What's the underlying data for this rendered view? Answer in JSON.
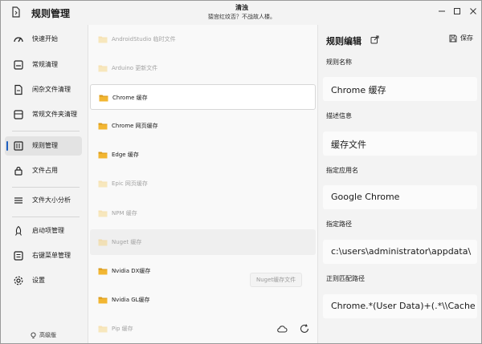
{
  "app": {
    "title": "规则管理",
    "header_title": "清浊",
    "header_subtitle": "猿宫红纹否？不战故人楼。"
  },
  "sidebar": {
    "items": [
      {
        "label": "快速开始",
        "icon": "gauge-icon"
      },
      {
        "label": "常规清理",
        "icon": "broom-icon"
      },
      {
        "label": "闲杂文件清理",
        "icon": "file-icon"
      },
      {
        "label": "常规文件夹清理",
        "icon": "folder-clean-icon"
      },
      {
        "label": "规则管理",
        "icon": "rules-icon",
        "active": true
      },
      {
        "label": "文件占用",
        "icon": "lock-icon"
      },
      {
        "label": "文件大小分析",
        "icon": "list-icon"
      },
      {
        "label": "启动项管理",
        "icon": "rocket-icon"
      },
      {
        "label": "右键菜单管理",
        "icon": "menu-icon"
      },
      {
        "label": "设置",
        "icon": "gear-icon"
      }
    ],
    "version": "高级版"
  },
  "rules": {
    "items": [
      {
        "name": "AndroidStudio 临时文件",
        "enabled": false
      },
      {
        "name": "Arduino 更新文件",
        "enabled": false
      },
      {
        "name": "Chrome 缓存",
        "enabled": true,
        "selected": true
      },
      {
        "name": "Chrome 网页缓存",
        "enabled": true
      },
      {
        "name": "Edge 缓存",
        "enabled": true
      },
      {
        "name": "Epic 网页缓存",
        "enabled": false
      },
      {
        "name": "NPM 缓存",
        "enabled": false
      },
      {
        "name": "Nuget 缓存",
        "enabled": false,
        "hover": true
      },
      {
        "name": "Nvidia DX缓存",
        "enabled": true
      },
      {
        "name": "Nvidia GL缓存",
        "enabled": true
      },
      {
        "name": "Pip 缓存",
        "enabled": false
      }
    ],
    "tooltip": "Nuget缓存文件"
  },
  "editor": {
    "title": "规则编辑",
    "save_label": "保存",
    "fields": [
      {
        "label": "规则名称",
        "value": "Chrome 缓存"
      },
      {
        "label": "描述信息",
        "value": "缓存文件"
      },
      {
        "label": "指定应用名",
        "value": "Google Chrome"
      },
      {
        "label": "指定路径",
        "value": "c:\\users\\administrator\\appdata\\"
      },
      {
        "label": "正则匹配路径",
        "value": "Chrome.*(User Data)+(.*\\\\Cache"
      }
    ]
  },
  "colors": {
    "accent": "#1f5fbf",
    "folder": "#f2b632",
    "folder_dark": "#d99a1a"
  }
}
